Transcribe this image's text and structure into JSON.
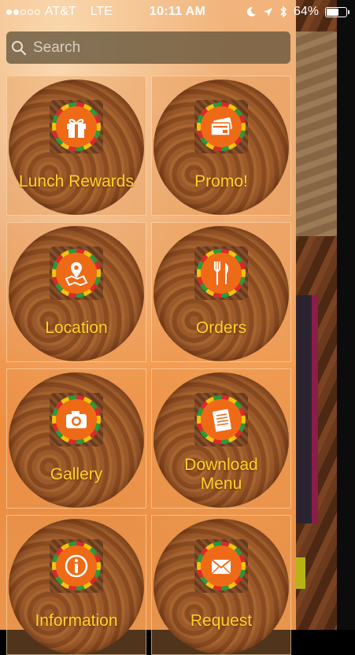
{
  "status_bar": {
    "carrier": "AT&T",
    "network": "LTE",
    "time": "10:11 AM",
    "battery": "64%",
    "battery_level": 0.64,
    "signal_bars_filled": 2
  },
  "search": {
    "placeholder": "Search",
    "value": ""
  },
  "menu": {
    "items": [
      {
        "label": "Lunch Rewards",
        "icon": "gift-icon"
      },
      {
        "label": "Promo!",
        "icon": "coupon-icon"
      },
      {
        "label": "Location",
        "icon": "map-pin-icon"
      },
      {
        "label": "Orders",
        "icon": "fork-knife-icon"
      },
      {
        "label": "Gallery",
        "icon": "camera-icon"
      },
      {
        "label": "Download Menu",
        "label_line1": "Download",
        "label_line2": "Menu",
        "icon": "document-icon"
      },
      {
        "label": "Information",
        "icon": "info-icon"
      },
      {
        "label": "Request",
        "icon": "envelope-icon"
      }
    ]
  },
  "colors": {
    "label": "#ffd32a",
    "badge_orange": "#ef6a16",
    "drawer_top": "#f0b27a",
    "drawer_mid": "#f08a3a"
  }
}
